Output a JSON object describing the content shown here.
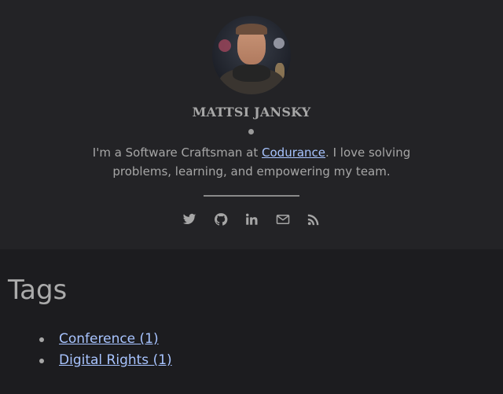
{
  "profile": {
    "name": "MATTSI JANSKY",
    "bio_before": "I'm a Software Craftsman at ",
    "bio_link": "Codurance",
    "bio_after": ". I love solving problems, learning, and empowering my team."
  },
  "social": {
    "icons": [
      "twitter-icon",
      "github-icon",
      "linkedin-icon",
      "envelope-icon",
      "rss-icon"
    ],
    "icon_color": "#a6a6a6"
  },
  "colors": {
    "header_bg": "#232326",
    "page_bg": "#1c1c1f",
    "link": "#a8c4ff",
    "text": "#a6a6a6"
  },
  "tags": {
    "title": "Tags",
    "items": [
      {
        "label": "Conference (1)"
      },
      {
        "label": "Digital Rights (1)"
      }
    ]
  }
}
